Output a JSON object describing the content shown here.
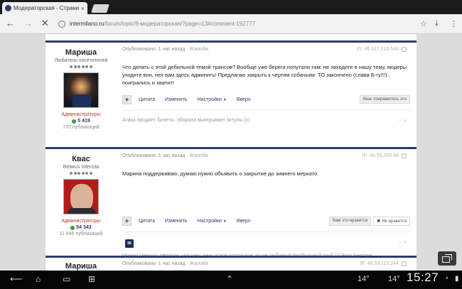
{
  "browser": {
    "tab_title": "Модераторская - Страница 9",
    "url_domain": "intermilano.ru",
    "url_path": "/forum/topic/9-модераторская/?page=13#comment-192777",
    "tab_close_glyph": "×",
    "nav_back": "←",
    "nav_forward": "→",
    "nav_stop": "✕",
    "star_glyph": "☆",
    "download_glyph": "⤓",
    "menu_glyph": "⋮"
  },
  "posts": [
    {
      "author": "Мариша",
      "member_title": "Любитель посетителей",
      "group": "Администраторы",
      "reputation": "5 419",
      "posts_count": "770 публикаций",
      "published": "Опубликовано: 1 час назад",
      "report": "· Жалоба",
      "meta_right": "ID: 46 317 215 544",
      "body": "Что делать с этой дебильной темой трансов? Вообще уже берега попутали там: не заходите в нашу тему, модеры уходите вон, нех вам здесь админить! Предлагаю закрыть к чертям собачьим: ТО закончено (слава Б-гу!!!) , поигрались и хватит!",
      "actions": [
        "Цитата",
        "Изменить",
        "Настройки",
        "Вверх"
      ],
      "reaction_pills": [
        "Квас понравилось это"
      ],
      "signature": "Атака продаёт билеты, оборона выигрывает титулы (с)",
      "sig_right": "☆ ▾"
    },
    {
      "author": "Квас",
      "member_title": "Belarus Interista",
      "group": "Администраторы",
      "reputation": "54 343",
      "posts_count": "11 846 публикаций",
      "published": "Опубликовано: 1 час назад",
      "report": "· Жалоба",
      "meta_right": "IP: 46.53.200.94",
      "body": "Марина поддерживаю, думаю нужно объявить о закрытие до зимнего меркато.",
      "actions": [
        "Цитата",
        "Изменить",
        "Настройки",
        "Вверх"
      ],
      "reaction_pills": [
        "Вам это нравится",
        "Не нравится"
      ],
      "jersey_number": "96",
      "signature": "Можно сменить религию, машину, жену и все остальное, но не любимый футбольный клуб (с)Эрик Кантона",
      "sig_right": "☆ ▾"
    },
    {
      "author": "Мариша",
      "published": "Опубликовано: 1 час назад",
      "report": "· Жалоба",
      "meta_right": "IP: 46.53.113.244"
    }
  ],
  "system_bar": {
    "back_glyph": "⟵",
    "home_glyph": "⌂",
    "recent_glyph": "▭",
    "screenshot_glyph": "⊞",
    "up_glyph": "⌃",
    "temp1": "14°",
    "temp2": "14°",
    "clock": "15:27",
    "wifi_glyph": "◔",
    "battery_glyph": "▮"
  },
  "colors": {
    "brand": "#2a3d6c",
    "admin_group": "#c0392b",
    "reputation_dot": "#3c9a3c"
  }
}
